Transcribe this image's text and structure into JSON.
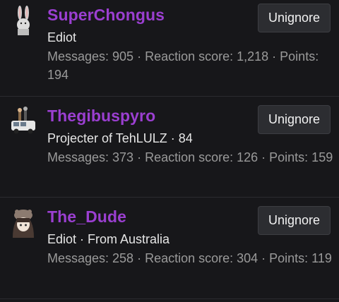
{
  "members": [
    {
      "username": "SuperChongus",
      "title": "Ediot",
      "stats": "Messages: 905 · Reaction score: 1,218 · Points: 194",
      "button": "Unignore",
      "avatar_icon": "bunny-avatar"
    },
    {
      "username": "Thegibuspyro",
      "title": "Projecter of TehLULZ · 84",
      "stats": "Messages: 373 · Reaction score: 126 · Points: 159",
      "button": "Unignore",
      "avatar_icon": "van-avatar"
    },
    {
      "username": "The_Dude",
      "title": "Ediot · From Australia",
      "stats": "Messages: 258 · Reaction score: 304 · Points: 119",
      "button": "Unignore",
      "avatar_icon": "anime-girl-avatar"
    }
  ],
  "colors": {
    "username": "#9b3fd1",
    "background": "#17171a",
    "button_bg": "#2c2d31"
  }
}
